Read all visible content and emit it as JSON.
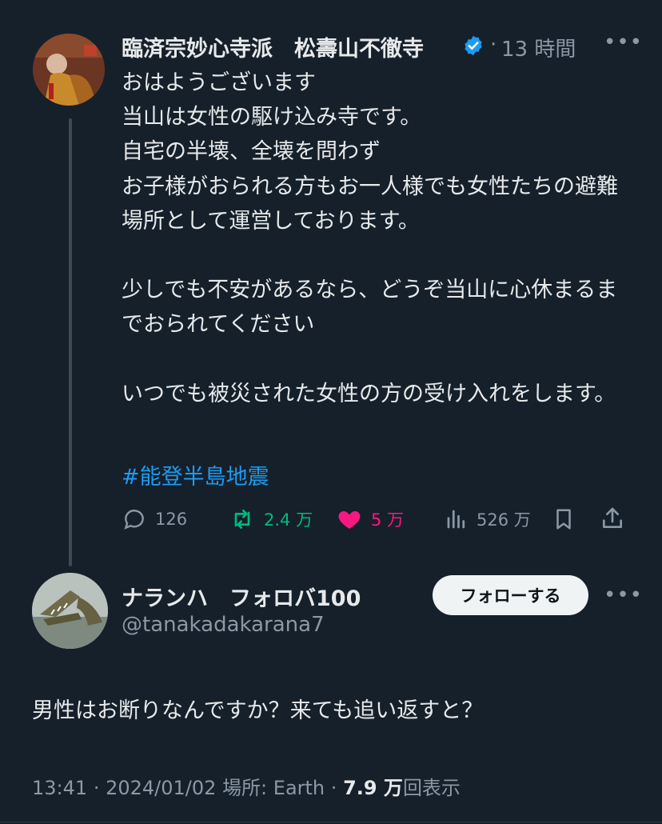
{
  "original_post": {
    "author_name": "臨済宗妙心寺派　松壽山不徹寺",
    "verified": true,
    "separator": "·",
    "time_ago": "13 時間",
    "text": "おはようございます\n当山は女性の駆け込み寺です。\n自宅の半壊、全壊を問わず\nお子様がおられる方もお一人様でも女性たちの避難場所として運営しております。\n\n少しでも不安があるなら、どうぞ当山に心休まるまでおられてください\n\nいつでも被災された女性の方の受け入れをします。",
    "hashtag": "#能登半島地震",
    "stats": {
      "replies": "126",
      "reposts": "2.4 万",
      "likes": "5 万",
      "views": "526 万"
    }
  },
  "reply": {
    "author_name": "ナランハ　フォロバ100",
    "handle": "@tanakadakarana7",
    "follow_label": "フォローする",
    "text": "男性はお断りなんですか？来ても追い返すと？",
    "meta": {
      "time": "13:41",
      "sep1": "·",
      "date": "2024/01/02",
      "location": "場所: Earth",
      "sep2": "·",
      "views_count": "7.9 万",
      "views_label": "回表示"
    }
  },
  "colors": {
    "background": "#15202b",
    "text": "#e7e9ea",
    "muted": "#8b98a5",
    "link": "#1d9bf0",
    "repost": "#00ba7c",
    "like": "#f91880"
  },
  "icons": [
    "verified-badge-icon",
    "more-icon",
    "reply-icon",
    "repost-icon",
    "heart-icon",
    "views-icon",
    "bookmark-icon",
    "share-icon"
  ]
}
